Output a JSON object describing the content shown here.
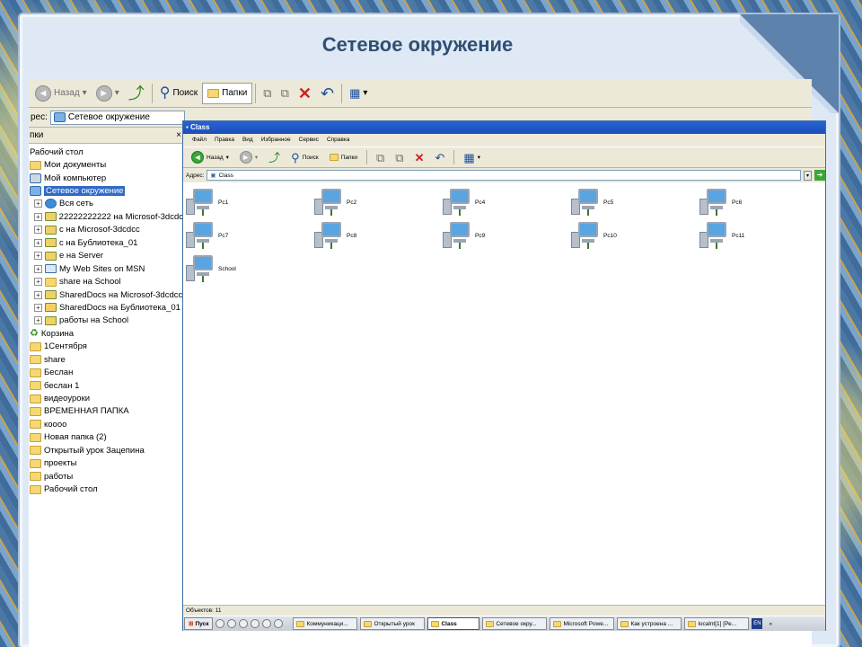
{
  "slide": {
    "title": "Сетевое окружение"
  },
  "back_window": {
    "toolbar": {
      "back": "Назад",
      "search": "Поиск",
      "folders": "Папки"
    },
    "address": {
      "label": "рес:",
      "value": "Сетевое окружение"
    },
    "tree_header": "пки",
    "tree_close": "×",
    "tree": [
      {
        "label": "Рабочий стол",
        "level": 0,
        "icon": "none"
      },
      {
        "label": "Мои документы",
        "level": 0,
        "icon": "folder-icon"
      },
      {
        "label": "Мой компьютер",
        "level": 0,
        "icon": "computer-icon"
      },
      {
        "label": "Сетевое окружение",
        "level": 0,
        "icon": "network-icon",
        "selected": true
      },
      {
        "label": "Вся сеть",
        "level": 1,
        "icon": "globe-icon"
      },
      {
        "label": "22222222222 на Microsof-3dcdc",
        "level": 1,
        "icon": "network-folder-icon"
      },
      {
        "label": "с на Microsof-3dcdcc",
        "level": 1,
        "icon": "network-folder-icon"
      },
      {
        "label": "с на Бублиотека_01",
        "level": 1,
        "icon": "network-folder-icon"
      },
      {
        "label": "е на Server",
        "level": 1,
        "icon": "network-folder-icon"
      },
      {
        "label": "My Web Sites on MSN",
        "level": 1,
        "icon": "web-folder-icon"
      },
      {
        "label": "share на School",
        "level": 1,
        "icon": "folder-icon"
      },
      {
        "label": "SharedDocs на Microsof-3dcdcc",
        "level": 1,
        "icon": "network-folder-icon"
      },
      {
        "label": "SharedDocs на Бублиотека_01",
        "level": 1,
        "icon": "network-folder-icon"
      },
      {
        "label": "работы на School",
        "level": 1,
        "icon": "network-folder-icon"
      },
      {
        "label": "Корзина",
        "level": 0,
        "icon": "recycle-bin-icon"
      },
      {
        "label": "1Сентября",
        "level": 0,
        "icon": "folder-icon"
      },
      {
        "label": "share",
        "level": 0,
        "icon": "folder-icon"
      },
      {
        "label": "Беслан",
        "level": 0,
        "icon": "folder-icon"
      },
      {
        "label": "беслан 1",
        "level": 0,
        "icon": "folder-icon"
      },
      {
        "label": "видеоуроки",
        "level": 0,
        "icon": "folder-icon"
      },
      {
        "label": "ВРЕМЕННАЯ ПАПКА",
        "level": 0,
        "icon": "folder-icon"
      },
      {
        "label": "коооо",
        "level": 0,
        "icon": "folder-icon"
      },
      {
        "label": "Новая папка (2)",
        "level": 0,
        "icon": "folder-icon"
      },
      {
        "label": "Открытый урок Зацепина",
        "level": 0,
        "icon": "folder-icon"
      },
      {
        "label": "проекты",
        "level": 0,
        "icon": "folder-icon"
      },
      {
        "label": "работы",
        "level": 0,
        "icon": "folder-icon"
      },
      {
        "label": "Рабочий стол",
        "level": 0,
        "icon": "folder-icon"
      }
    ]
  },
  "front_window": {
    "title": "Class",
    "menu": [
      "Файл",
      "Правка",
      "Вид",
      "Избранное",
      "Сервис",
      "Справка"
    ],
    "toolbar": {
      "back": "Назад",
      "search": "Поиск",
      "folders": "Папки"
    },
    "address": {
      "label": "Адрес:",
      "value": "Class"
    },
    "computers": [
      {
        "name": "Pc1"
      },
      {
        "name": "Pc2"
      },
      {
        "name": "Pc4"
      },
      {
        "name": "Pc5"
      },
      {
        "name": "Pc6"
      },
      {
        "name": "Pc7"
      },
      {
        "name": "Pc8"
      },
      {
        "name": "Pc9"
      },
      {
        "name": "Pc10"
      },
      {
        "name": "Pc11"
      },
      {
        "name": "School"
      }
    ],
    "status": "Объектов: 11",
    "taskbar": {
      "start": "Пуск",
      "tasks": [
        {
          "label": "Коммуникаци..."
        },
        {
          "label": "Открытый урок"
        },
        {
          "label": "Class",
          "active": true
        },
        {
          "label": "Сетевое окру..."
        },
        {
          "label": "Microsoft Powe..."
        },
        {
          "label": "Как устроена ..."
        },
        {
          "label": "localnt[1] [Ре..."
        }
      ],
      "lang": "EN",
      "tray": "«"
    }
  }
}
